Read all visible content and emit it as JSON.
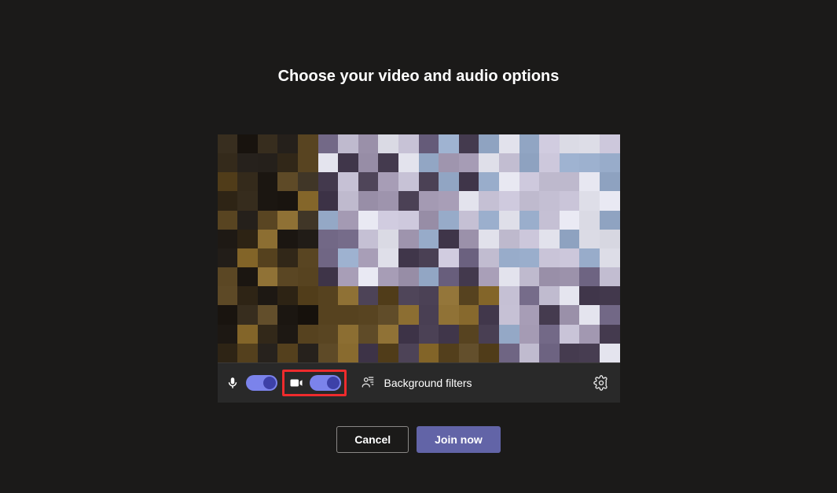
{
  "title": "Choose your video and audio options",
  "controls": {
    "mic_icon": "microphone-icon",
    "mic_on": true,
    "camera_icon": "video-camera-icon",
    "camera_on": true,
    "background_filters_label": "Background filters",
    "background_filters_icon": "background-effects-icon",
    "settings_icon": "gear-icon"
  },
  "buttons": {
    "cancel": "Cancel",
    "join": "Join now"
  },
  "accent_color": "#6264a7",
  "toggle_track_color": "#7b83eb",
  "toggle_knob_color": "#3d41a8",
  "highlight_color": "#ef2b2d"
}
